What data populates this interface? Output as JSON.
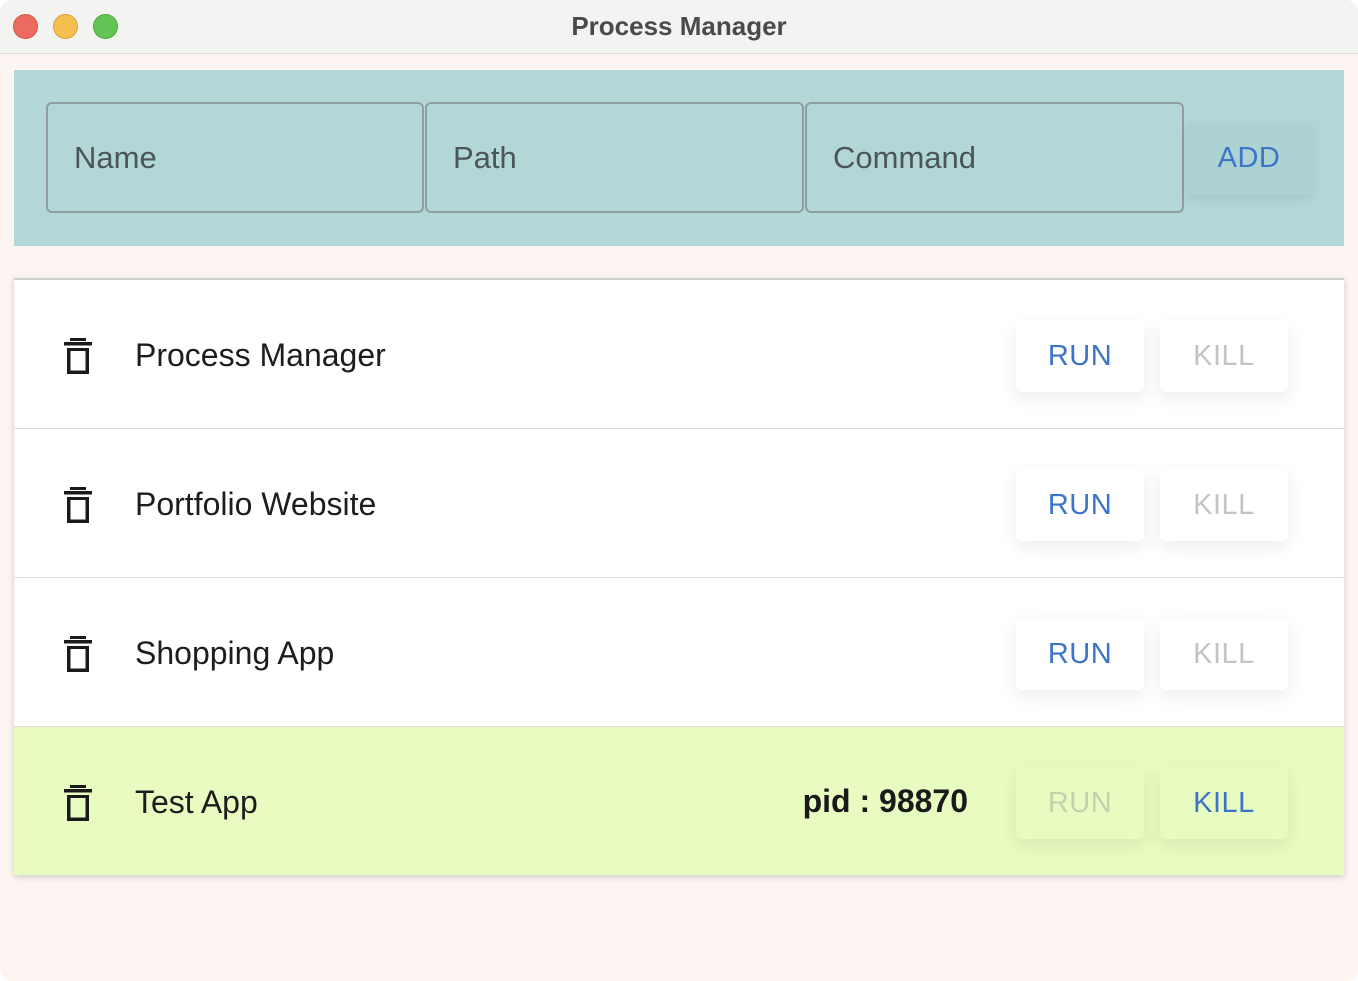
{
  "window": {
    "title": "Process Manager"
  },
  "form": {
    "name_placeholder": "Name",
    "path_placeholder": "Path",
    "command_placeholder": "Command",
    "add_label": "ADD"
  },
  "processes": [
    {
      "name": "Process Manager",
      "pid_text": "",
      "run_label": "RUN",
      "kill_label": "KILL",
      "running": false
    },
    {
      "name": "Portfolio Website",
      "pid_text": "",
      "run_label": "RUN",
      "kill_label": "KILL",
      "running": false
    },
    {
      "name": "Shopping App",
      "pid_text": "",
      "run_label": "RUN",
      "kill_label": "KILL",
      "running": false
    },
    {
      "name": "Test App",
      "pid_text": "pid : 98870",
      "run_label": "RUN",
      "kill_label": "KILL",
      "running": true
    }
  ],
  "colors": {
    "accent": "#3b74c8",
    "form_bar": "#b3d7d7",
    "running_row": "#e8fcc1",
    "background": "#fdf5f1"
  },
  "icons": {
    "delete": "trash-icon"
  }
}
